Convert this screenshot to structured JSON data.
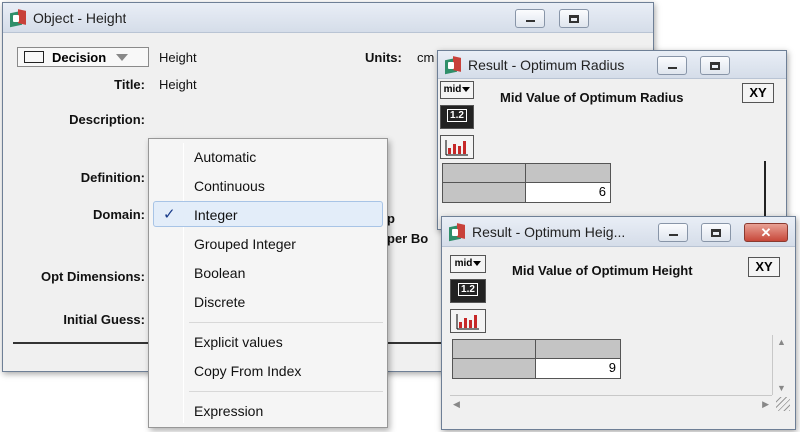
{
  "object_window": {
    "title": "Object - Height",
    "class_select": "Decision",
    "identifier": "Height",
    "units_label": "Units:",
    "units_value": "cm",
    "title_label": "Title:",
    "title_value": "Height",
    "description_label": "Description:",
    "definition_label": "Definition:",
    "domain_label": "Domain:",
    "opt_dimensions_label": "Opt Dimensions:",
    "initial_guess_label": "Initial Guess:",
    "partial_domain_suffix": "p",
    "partial_upper_bound": "per Bo"
  },
  "domain_menu": {
    "items": [
      {
        "label": "Automatic",
        "checked": false
      },
      {
        "label": "Continuous",
        "checked": false
      },
      {
        "label": "Integer",
        "checked": true
      },
      {
        "label": "Grouped Integer",
        "checked": false
      },
      {
        "label": "Boolean",
        "checked": false
      },
      {
        "label": "Discrete",
        "checked": false
      },
      {
        "label": "Explicit values",
        "checked": false
      },
      {
        "label": "Copy From Index",
        "checked": false
      },
      {
        "label": "Expression",
        "checked": false
      }
    ],
    "check_glyph": "✓"
  },
  "result_radius": {
    "title": "Result - Optimum Radius",
    "mid_select": "mid",
    "heading": "Mid Value of Optimum Radius",
    "xy_button": "XY",
    "table_button": "1.2",
    "value": "6"
  },
  "result_height": {
    "title": "Result - Optimum Heig...",
    "mid_select": "mid",
    "heading": "Mid Value of Optimum Height",
    "xy_button": "XY",
    "table_button": "1.2",
    "value": "9"
  },
  "colors": {
    "titlebar": "#dfe5ee",
    "menu_highlight": "#e3edf9",
    "close_button": "#c7483a",
    "grid_gray": "#c4c4c4"
  }
}
